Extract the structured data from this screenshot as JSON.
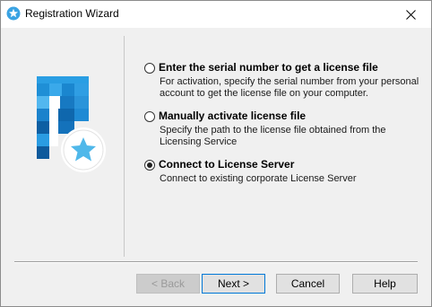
{
  "window": {
    "title": "Registration Wizard",
    "close_glyph": "✕"
  },
  "options": [
    {
      "label": "Enter the serial number to get a license file",
      "description": "For activation, specify the serial number from your personal account to get the license file on your computer.",
      "selected": false
    },
    {
      "label": "Manually activate license file",
      "description": "Specify the path to the license file obtained from the Licensing Service",
      "selected": false
    },
    {
      "label": "Connect to License Server",
      "description": "Connect to existing corporate License Server",
      "selected": true
    }
  ],
  "buttons": {
    "back": "< Back",
    "next": "Next >",
    "cancel": "Cancel",
    "help": "Help"
  },
  "colors": {
    "logo_blue": "#1e90d8",
    "star_badge": "#4fb8ea",
    "accent": "#0078d7"
  }
}
